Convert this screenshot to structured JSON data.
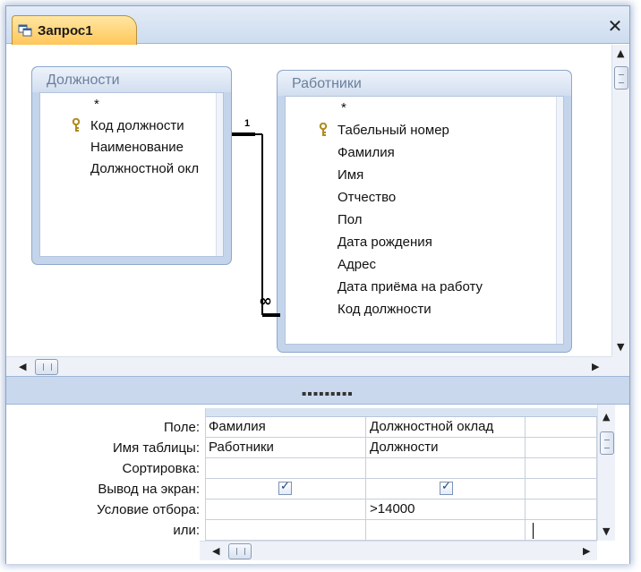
{
  "window": {
    "tab_title": "Запрос1",
    "close_symbol": "✕"
  },
  "tables": [
    {
      "title": "Должности",
      "fields": [
        "*",
        "Код должности",
        "Наименование",
        "Должностной окл"
      ],
      "key_field_index": 1
    },
    {
      "title": "Работники",
      "fields": [
        "*",
        "Табельный номер",
        "Фамилия",
        "Имя",
        "Отчество",
        "Пол",
        "Дата рождения",
        "Адрес",
        "Дата приёма на работу",
        "Код должности"
      ],
      "key_field_index": 1
    }
  ],
  "relationship": {
    "one_side_label": "1",
    "many_side_label": "∞"
  },
  "query_grid": {
    "row_labels": [
      "Поле:",
      "Имя таблицы:",
      "Сортировка:",
      "Вывод на экран:",
      "Условие отбора:",
      "или:"
    ],
    "columns": [
      {
        "field": "Фамилия",
        "table": "Работники",
        "sort": "",
        "show": true,
        "criteria": "",
        "or": ""
      },
      {
        "field": "Должностной оклад",
        "table": "Должности",
        "sort": "",
        "show": true,
        "criteria": ">14000",
        "or": ""
      }
    ]
  },
  "icons": {
    "tab": "query-icon",
    "key": "key-icon",
    "close": "close-icon"
  },
  "colors": {
    "tab_active": "#ffc759",
    "table_frame": "#c4d4ea",
    "table_header_text": "#6b7f9d",
    "window_border": "#8aa4c8"
  }
}
